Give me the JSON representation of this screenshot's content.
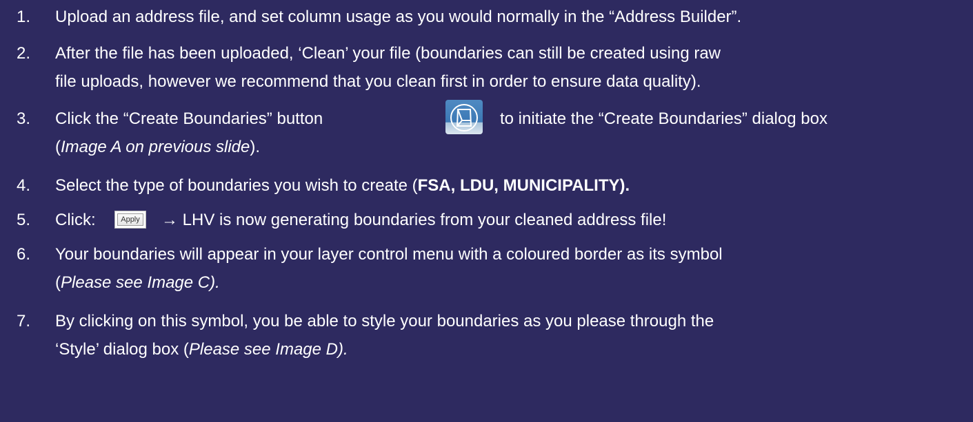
{
  "steps": [
    {
      "number": "1.",
      "text": "Upload an address file, and set column usage as you would normally in the “Address Builder”."
    },
    {
      "number": "2.",
      "line1": "After the file has been uploaded, ‘Clean’ your file (boundaries can still be created using raw",
      "line2": "file uploads, however we recommend that you clean first in order to ensure data quality)."
    },
    {
      "number": "3.",
      "before_icon": "Click the “Create Boundaries” button",
      "icon": "create-boundaries-icon",
      "after_icon": "to initiate the “Create Boundaries” dialog box",
      "line2_open": "(",
      "line2_italic": "Image A on previous slide",
      "line2_close": ")."
    },
    {
      "number": "4.",
      "text": "Select the type of boundaries you wish to create (",
      "bold_text": "FSA, LDU, MUNICIPALITY)."
    },
    {
      "number": "5.",
      "label": "Click:",
      "button_label": "Apply",
      "arrow": "→",
      "after_button": "LHV is now generating boundaries from your cleaned address file!"
    },
    {
      "number": "6.",
      "line1": "Your boundaries will appear in your layer control menu with a coloured border as its symbol",
      "line2_open": "(",
      "line2_italic": "Please see Image C)."
    },
    {
      "number": "7.",
      "line1": "By clicking on this symbol, you be able to style your boundaries as you please through the",
      "line2_text": "‘Style’ dialog box (",
      "line2_italic": "Please see Image D)."
    }
  ],
  "colors": {
    "background": "#2e2a60",
    "text": "#ffffff",
    "icon_blue": "#3b78b5"
  }
}
